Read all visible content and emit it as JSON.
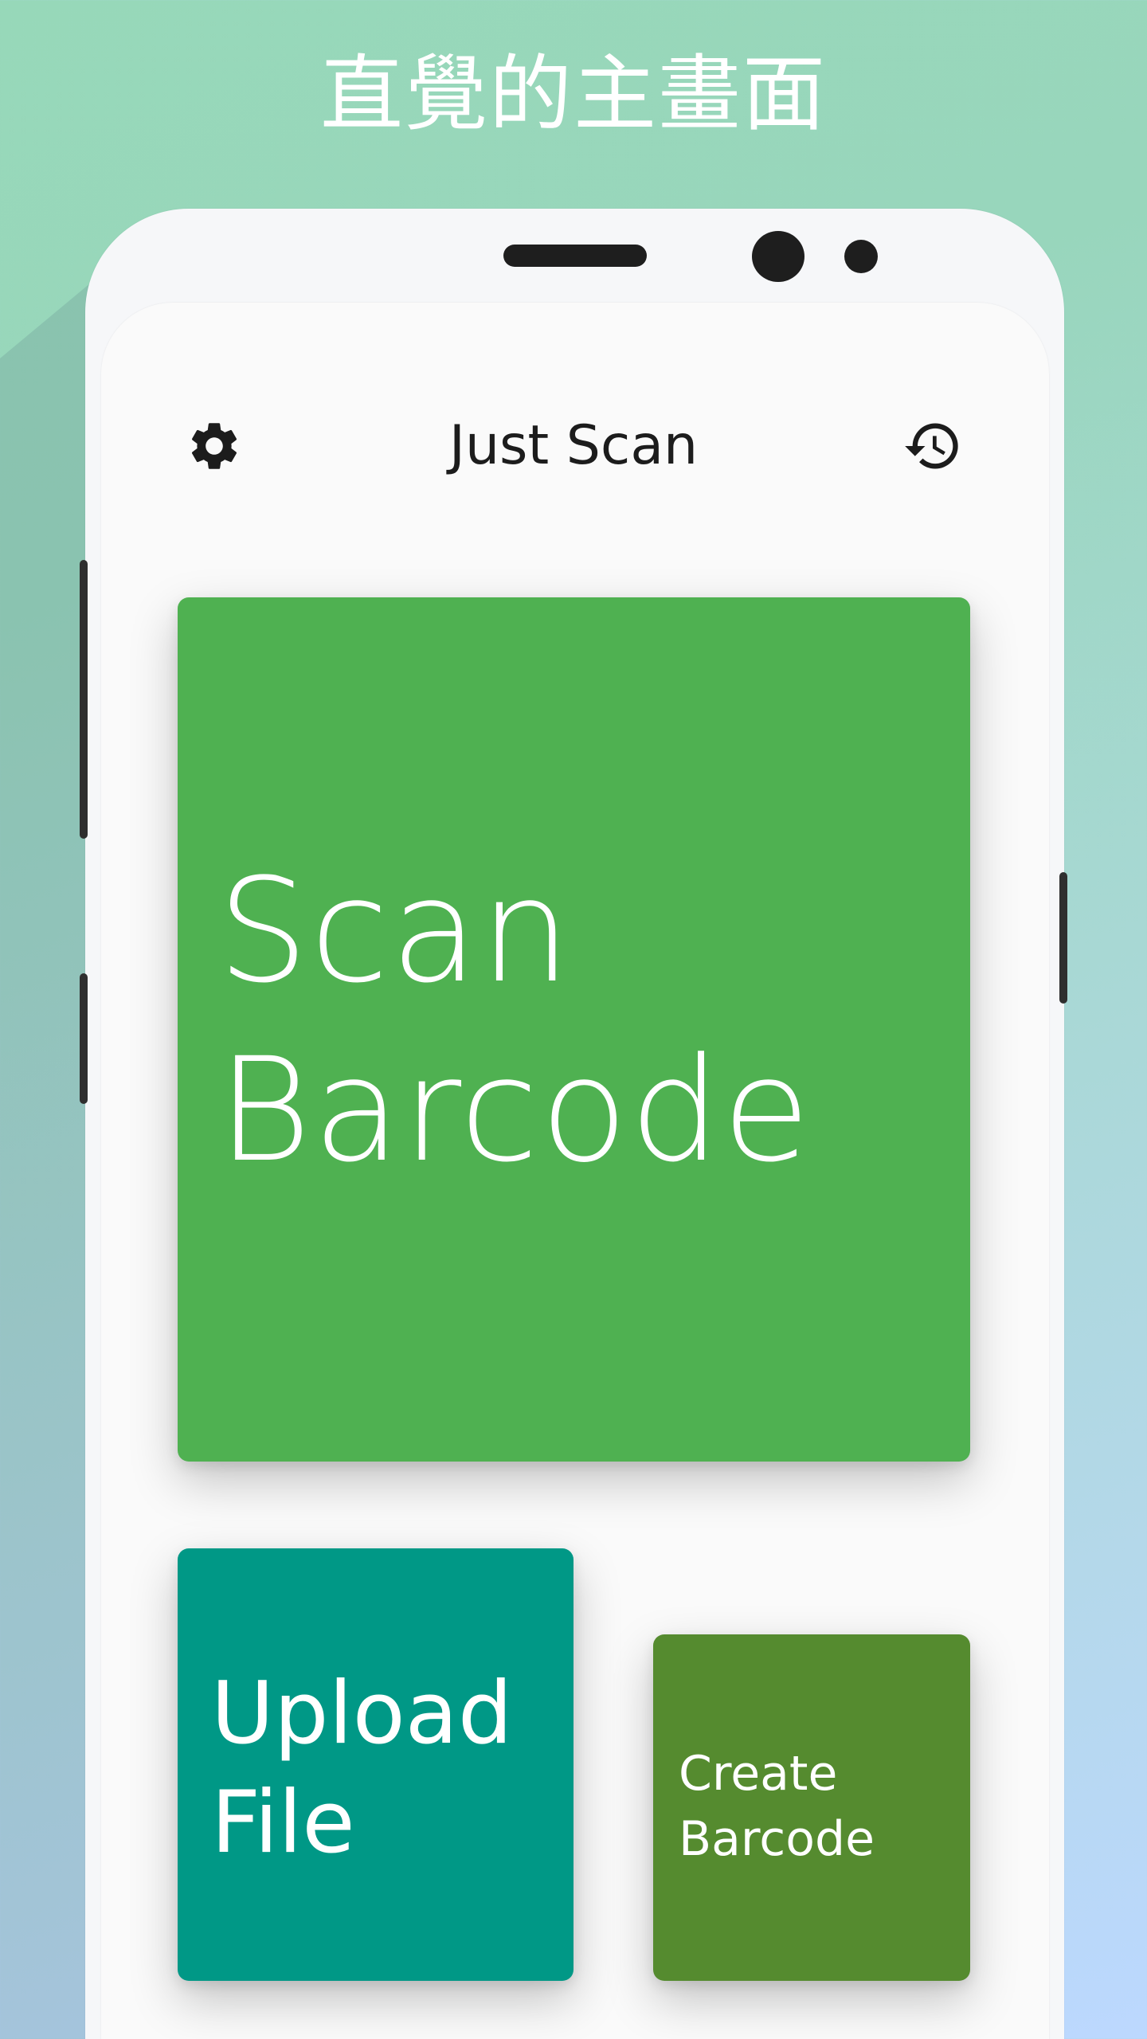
{
  "banner": {
    "headline": "直覺的主畫面"
  },
  "app": {
    "title": "Just Scan",
    "settings_icon": "gear-icon",
    "history_icon": "history-icon"
  },
  "tiles": {
    "scan": {
      "line1": "Scan",
      "line2": "Barcode",
      "color": "#4fb151"
    },
    "upload": {
      "line1": "Upload",
      "line2": "File",
      "color": "#009886"
    },
    "create": {
      "line1": "Create",
      "line2": "Barcode",
      "color": "#558b2f"
    }
  }
}
